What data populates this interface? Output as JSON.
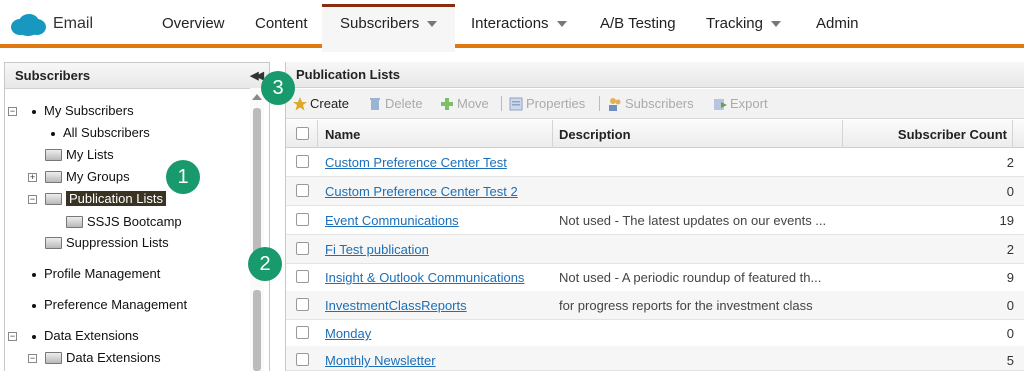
{
  "app": {
    "name": "Email"
  },
  "nav": {
    "items": [
      {
        "label": "Overview"
      },
      {
        "label": "Content"
      },
      {
        "label": "Subscribers"
      },
      {
        "label": "Interactions"
      },
      {
        "label": "A/B Testing"
      },
      {
        "label": "Tracking"
      },
      {
        "label": "Admin"
      }
    ],
    "active": "Subscribers"
  },
  "sidebar": {
    "title": "Subscribers",
    "collapse_icon": "double-chevron-left-icon",
    "tree": [
      {
        "label": "My Subscribers",
        "type": "bullet",
        "expander": "-"
      },
      {
        "label": "All Subscribers",
        "type": "bullet"
      },
      {
        "label": "My Lists",
        "type": "folder"
      },
      {
        "label": "My Groups",
        "type": "folder",
        "expander": "+"
      },
      {
        "label": "Publication Lists",
        "type": "folder",
        "expander": "-",
        "selected": true
      },
      {
        "label": "SSJS Bootcamp",
        "type": "folder"
      },
      {
        "label": "Suppression Lists",
        "type": "folder"
      },
      {
        "label": "Profile Management",
        "type": "bullet"
      },
      {
        "label": "Preference Management",
        "type": "bullet"
      },
      {
        "label": "Data Extensions",
        "type": "bullet",
        "expander": "-"
      },
      {
        "label": "Data Extensions",
        "type": "folder",
        "expander": "-"
      }
    ]
  },
  "main": {
    "title": "Publication Lists",
    "toolbar": {
      "create": "Create",
      "delete": "Delete",
      "move": "Move",
      "properties": "Properties",
      "subscribers": "Subscribers",
      "export": "Export"
    },
    "columns": {
      "name": "Name",
      "description": "Description",
      "count": "Subscriber Count"
    },
    "rows": [
      {
        "name": "Custom Preference Center Test",
        "description": "",
        "count": "2"
      },
      {
        "name": "Custom Preference Center Test 2",
        "description": "",
        "count": "0"
      },
      {
        "name": "Event Communications",
        "description": "Not used - The latest updates on our events ...",
        "count": "19"
      },
      {
        "name": "Fi Test publication",
        "description": "",
        "count": "2"
      },
      {
        "name": "Insight & Outlook Communications",
        "description": "Not used - A periodic roundup of featured th...",
        "count": "9"
      },
      {
        "name": "InvestmentClassReports",
        "description": "for progress reports for the investment class",
        "count": "0"
      },
      {
        "name": "Monday",
        "description": "",
        "count": "0"
      },
      {
        "name": "Monthly Newsletter",
        "description": "",
        "count": "5"
      }
    ]
  },
  "annotations": [
    {
      "label": "1"
    },
    {
      "label": "2"
    },
    {
      "label": "3"
    }
  ],
  "colors": {
    "accent": "#e07a10",
    "badge": "#189a6c",
    "link": "#1c6fb8",
    "active_tab_border": "#8a2c10"
  }
}
